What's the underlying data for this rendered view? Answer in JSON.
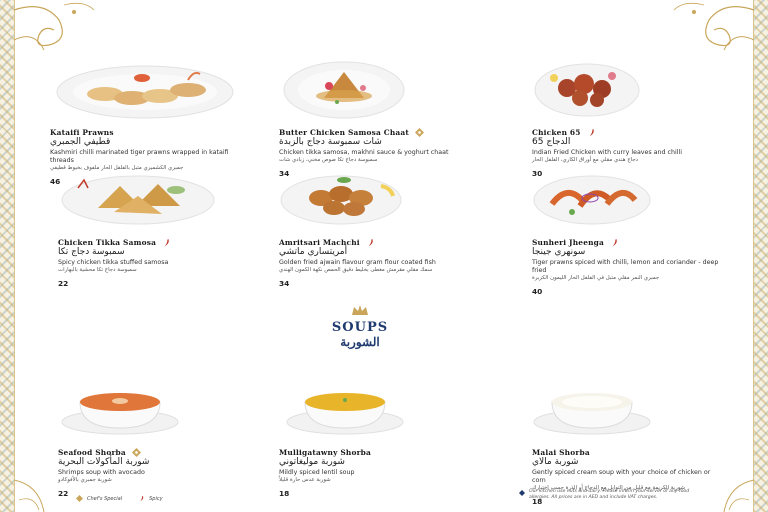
{
  "colors": {
    "gold": "#c9a65a",
    "navy": "#1e3a6e",
    "spicy": "#c0392b",
    "text": "#1f1f1f"
  },
  "dishes": [
    {
      "name_en": "Kataifi Prawns",
      "name_ar": "قطيفي الجمبري",
      "desc_en": "Kashmiri chilli marinated tiger prawns wrapped in kataifi threads",
      "desc_ar": "جمبري الكشميري متبل بالفلفل الحار ملفوف بخيوط قطيفي",
      "price": "46",
      "chef_special": false,
      "spicy": false
    },
    {
      "name_en": "Butter Chicken Samosa Chaat",
      "name_ar": "شات سمبوسة دجاج بالزبدة",
      "desc_en": "Chicken tikka samosa, makhni sauce & yoghurt chaat",
      "desc_ar": "سمبوسة دجاج تكا صوص مخني، زبادي شات",
      "price": "34",
      "chef_special": true,
      "spicy": false
    },
    {
      "name_en": "Chicken 65",
      "name_ar": "الدجاج 65",
      "desc_en": "Indian Fried Chicken with curry leaves and chilli",
      "desc_ar": "دجاج هندي مقلي مع أوراق الكاري، الفلفل الحار",
      "price": "30",
      "chef_special": false,
      "spicy": true
    },
    {
      "name_en": "Chicken Tikka Samosa",
      "name_ar": "سمبوسة دجاج تكا",
      "desc_en": "Spicy chicken tikka stuffed samosa",
      "desc_ar": "سمبوسة دجاج تكا محشية بالبهارات",
      "price": "22",
      "chef_special": false,
      "spicy": true
    },
    {
      "name_en": "Amritsari Machchi",
      "name_ar": "أمريتساري ماتشي",
      "desc_en": "Golden fried ajwain flavour gram flour coated fish",
      "desc_ar": "سمك مقلي مقرمش مغطى بخليط دقيق الحمص نكهة الكمون الهندي",
      "price": "34",
      "chef_special": false,
      "spicy": true
    },
    {
      "name_en": "Sunheri Jheenga",
      "name_ar": "سونهري جينجا",
      "desc_en": "Tiger prawns spiced with chilli, lemon and coriander - deep fried",
      "desc_ar": "جمبري النمر مقلي متبل في الفلفل الحار الليمون الكزبرة",
      "price": "40",
      "chef_special": false,
      "spicy": true
    }
  ],
  "soups": {
    "title_en": "SOUPS",
    "title_ar": "الشوربة",
    "items": [
      {
        "name_en": "Seafood Shorba",
        "name_ar": "شوربة المأكولات البحرية",
        "desc_en": "Shrimps soup with avocado",
        "desc_ar": "شوربة جمبري بالأفوكادو",
        "price": "22",
        "chef_special": true
      },
      {
        "name_en": "Mulligatawny Shorba",
        "name_ar": "شوربة موليغاتوني",
        "desc_en": "Mildly spiced lentil soup",
        "desc_ar": "شوربة عدس حارة قليلاً",
        "price": "18",
        "chef_special": false
      },
      {
        "name_en": "Malai Shorba",
        "name_ar": "شوربة مالاي",
        "desc_en": "Gently spiced cream soup with your choice of chicken or corn",
        "desc_ar": "شوربة الكريمة مع قليل من التوابل مع الدجاج أو الذرة حسب اختيارك",
        "price": "18",
        "chef_special": false
      }
    ]
  },
  "legend": {
    "chef_special": "Chef's Special",
    "spicy": "Spicy"
  },
  "disclaimer": "Our kitchen use nuts and dairy. Please inform your server of any food allergies. All prices are in AED and include VAT charges."
}
